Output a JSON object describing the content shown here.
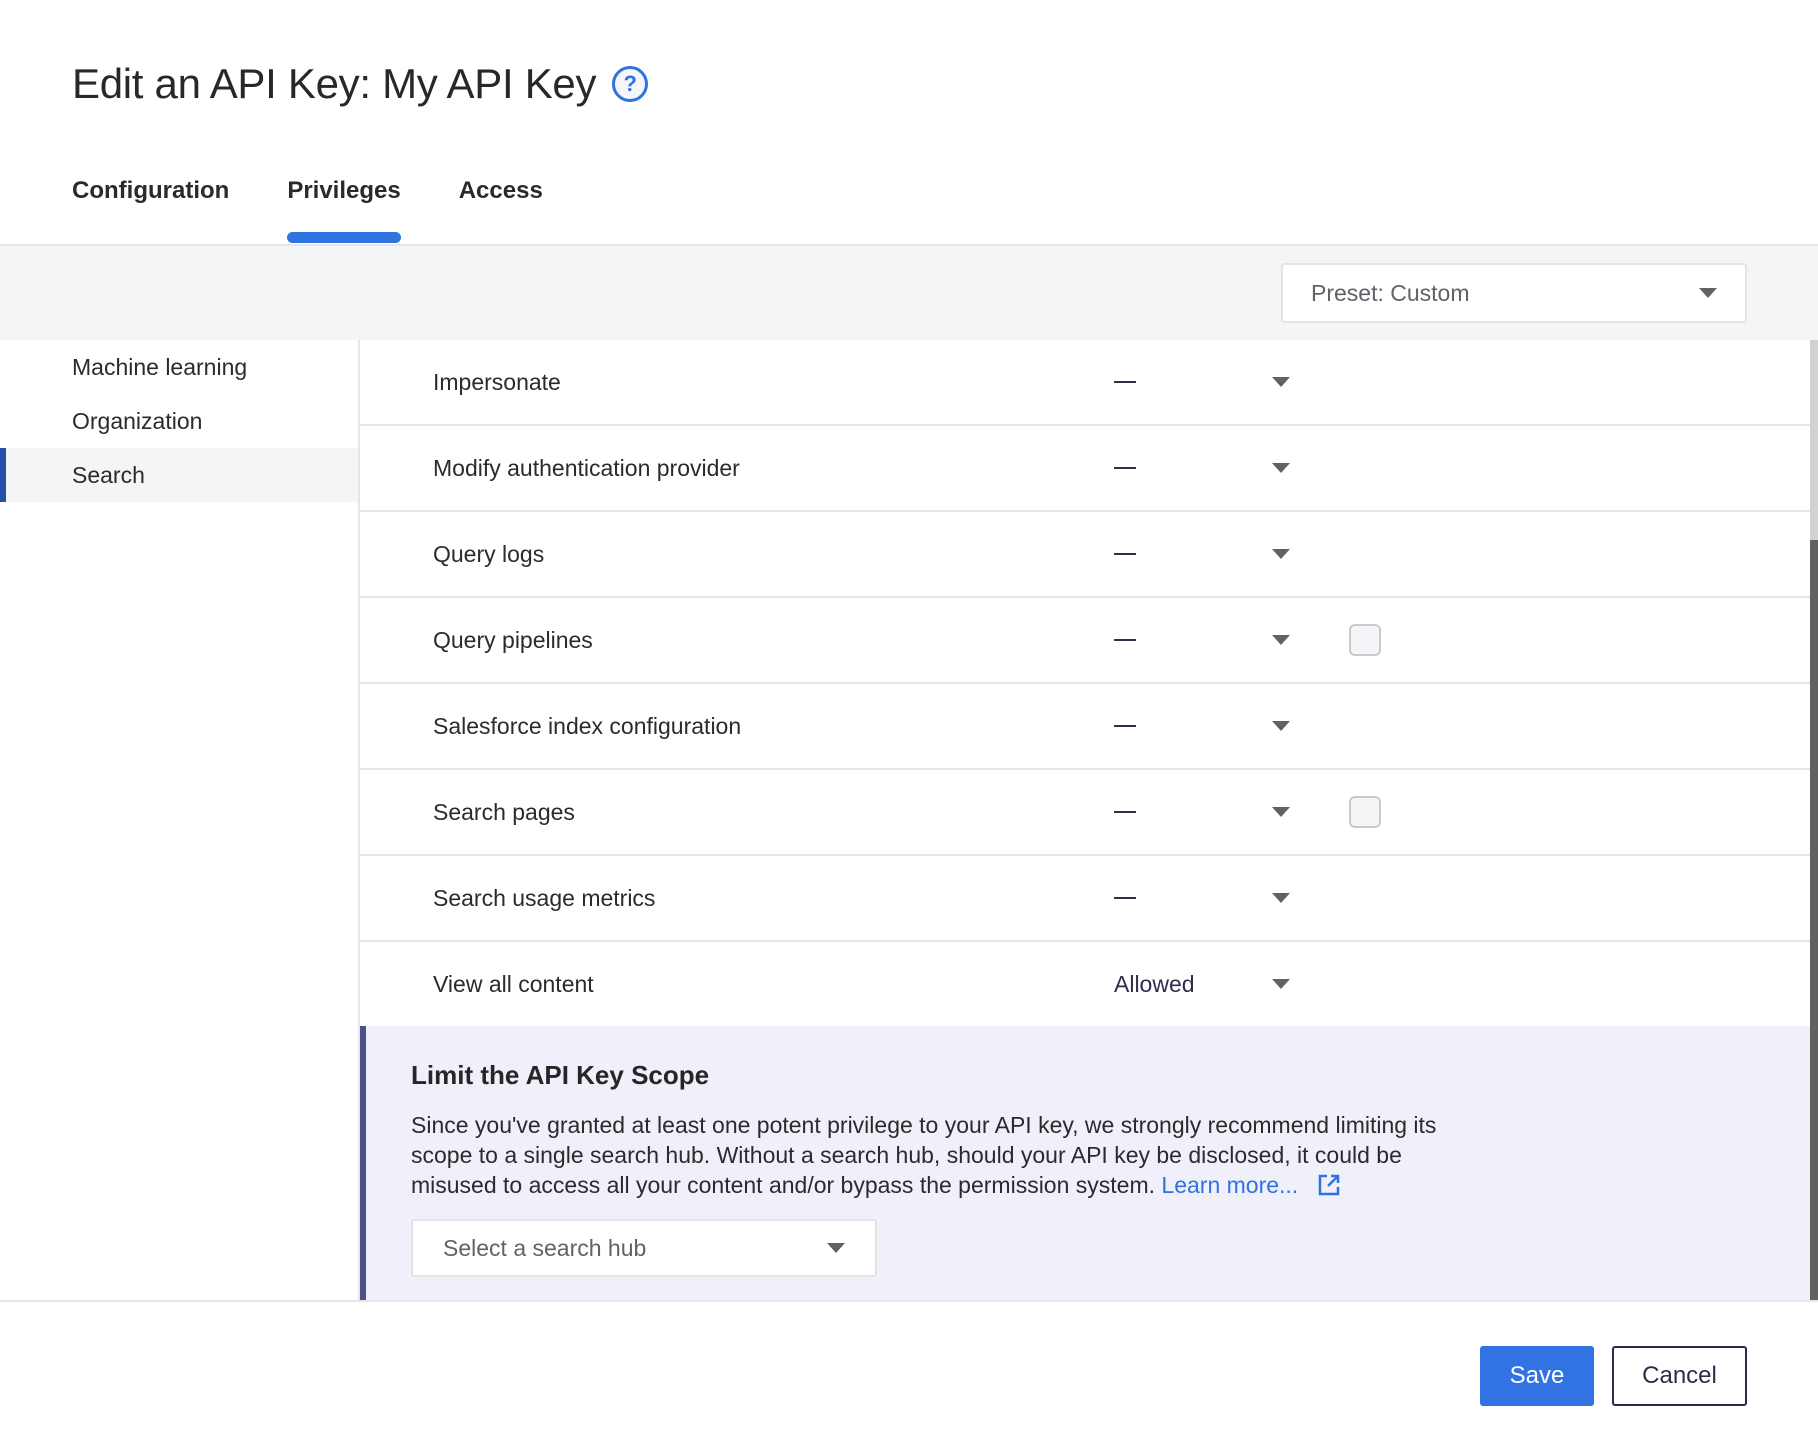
{
  "header": {
    "title": "Edit an API Key: My API Key",
    "help_icon": "question-circle-icon"
  },
  "tabs": [
    {
      "label": "Configuration",
      "active": false
    },
    {
      "label": "Privileges",
      "active": true
    },
    {
      "label": "Access",
      "active": false
    }
  ],
  "preset": {
    "label": "Preset:  Custom",
    "icon": "caret-down-icon"
  },
  "sidebar": {
    "items": [
      {
        "label": "Machine learning",
        "active": false
      },
      {
        "label": "Organization",
        "active": false
      },
      {
        "label": "Search",
        "active": true
      }
    ]
  },
  "privileges": {
    "rows": [
      {
        "label": "Impersonate",
        "value": "—",
        "has_checkbox": false
      },
      {
        "label": "Modify authentication provider",
        "value": "—",
        "has_checkbox": false
      },
      {
        "label": "Query logs",
        "value": "—",
        "has_checkbox": false
      },
      {
        "label": "Query pipelines",
        "value": "—",
        "has_checkbox": true,
        "checked": false
      },
      {
        "label": "Salesforce index configuration",
        "value": "—",
        "has_checkbox": false
      },
      {
        "label": "Search pages",
        "value": "—",
        "has_checkbox": true,
        "checked": false
      },
      {
        "label": "Search usage metrics",
        "value": "—",
        "has_checkbox": false
      },
      {
        "label": "View all content",
        "value": "Allowed",
        "has_checkbox": false
      }
    ]
  },
  "scope_panel": {
    "title": "Limit the API Key Scope",
    "text": "Since you've granted at least one potent privilege to your API key, we strongly recommend limiting its scope to a single search hub. Without a search hub, should your API key be disclosed, it could be misused to access all your content and/or bypass the permission system.",
    "link_label": "Learn more...",
    "link_icon": "external-link-icon",
    "hub_select_placeholder": "Select a search hub"
  },
  "footer": {
    "save_label": "Save",
    "cancel_label": "Cancel"
  },
  "colors": {
    "accent": "#2f73e0",
    "save_button": "#3173e3",
    "sidebar_active_bar": "#2850a8",
    "panel_background": "#f0f0fb",
    "panel_border": "#4b4f8a"
  }
}
